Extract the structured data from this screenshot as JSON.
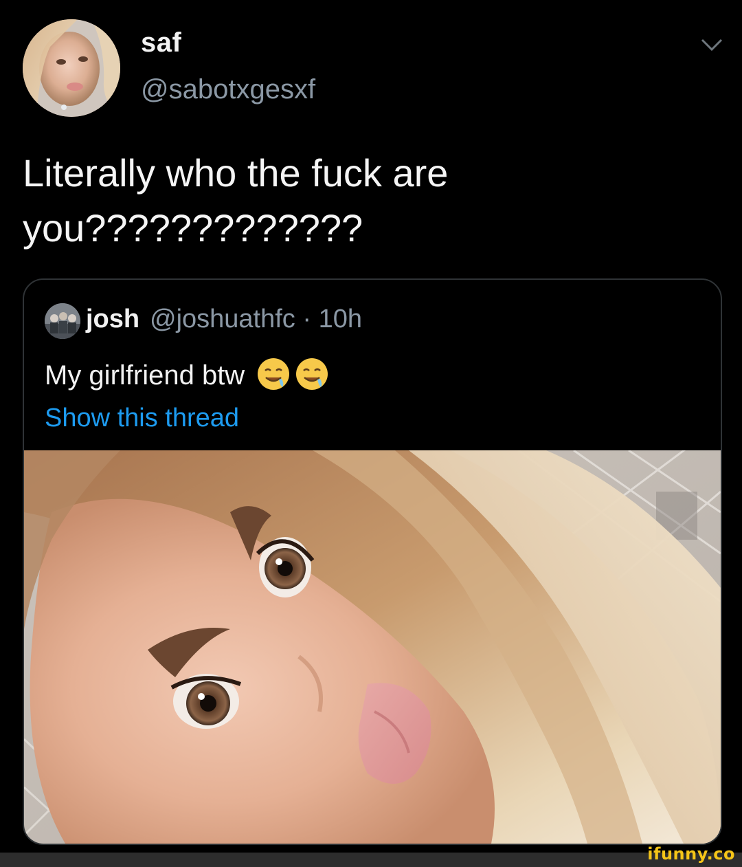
{
  "tweet": {
    "author_name": "saf",
    "author_handle": "@sabotxgesxf",
    "text_line1": "Literally who the fuck are",
    "text_line2": "you?????????????",
    "menu_icon": "chevron-down-icon"
  },
  "quoted_tweet": {
    "author_name": "josh",
    "author_handle": "@joshuathfc · 10h",
    "text": "My girlfriend btw",
    "emojis": [
      "drooling-face-icon",
      "drooling-face-icon"
    ],
    "link_text": "Show this thread",
    "link_color": "#1d9bf0",
    "media": "selfie-photo"
  },
  "watermark": "ifunny.co",
  "colors": {
    "background": "#000000",
    "text_primary": "#f2f2f2",
    "text_secondary": "#8b98a5",
    "border": "#2f3336",
    "watermark": "#f5c518"
  }
}
